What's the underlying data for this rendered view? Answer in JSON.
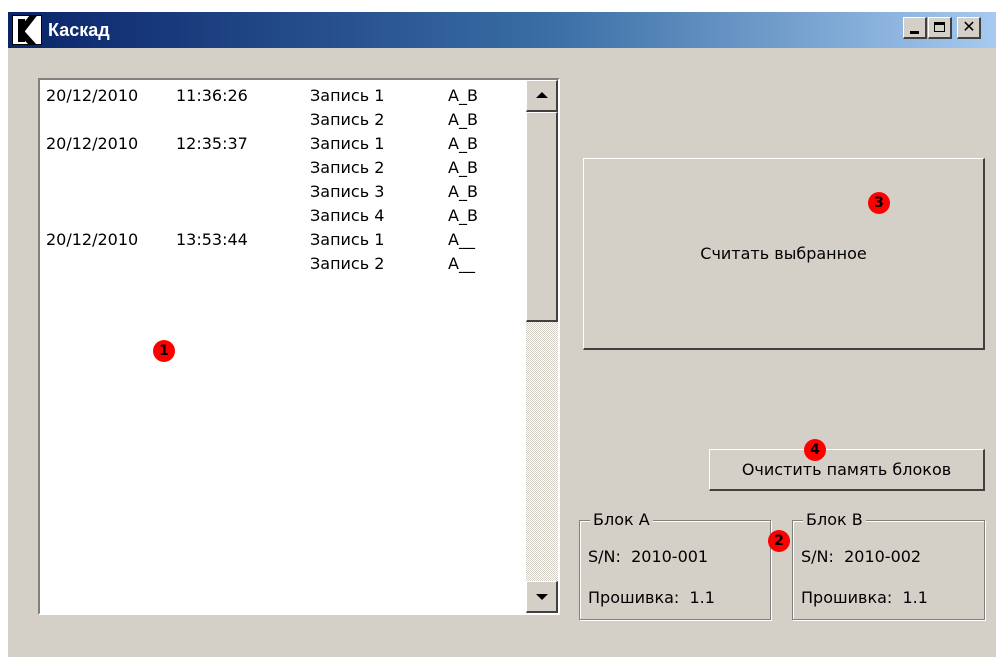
{
  "window": {
    "title": "Каскад",
    "logo_letter": "K",
    "icons": {
      "logo": "app-logo-k-icon",
      "minimize": "minimize-icon",
      "maximize": "maximize-icon",
      "close": "close-icon"
    },
    "close_glyph": "✕"
  },
  "records_list": {
    "rows": [
      {
        "date": "20/12/2010",
        "time": "11:36:26",
        "record": "Запись 1",
        "blocks": "A_B"
      },
      {
        "date": "",
        "time": "",
        "record": "Запись 2",
        "blocks": "A_B"
      },
      {
        "date": "20/12/2010",
        "time": "12:35:37",
        "record": "Запись 1",
        "blocks": "A_B"
      },
      {
        "date": "",
        "time": "",
        "record": "Запись 2",
        "blocks": "A_B"
      },
      {
        "date": "",
        "time": "",
        "record": "Запись 3",
        "blocks": "A_B"
      },
      {
        "date": "",
        "time": "",
        "record": "Запись 4",
        "blocks": "A_B"
      },
      {
        "date": "20/12/2010",
        "time": "13:53:44",
        "record": "Запись 1",
        "blocks": "A__"
      },
      {
        "date": "",
        "time": "",
        "record": "Запись 2",
        "blocks": "A__"
      }
    ]
  },
  "actions": {
    "read_selected": "Считать выбранное",
    "clear_memory": "Очистить память блоков"
  },
  "block_a": {
    "title": "Блок А",
    "sn_label": "S/N:",
    "sn_value": "2010-001",
    "fw_label": "Прошивка:",
    "fw_value": "1.1"
  },
  "block_b": {
    "title": "Блок В",
    "sn_label": "S/N:",
    "sn_value": "2010-002",
    "fw_label": "Прошивка:",
    "fw_value": "1.1"
  },
  "markers": {
    "m1": "1",
    "m2": "2",
    "m3": "3",
    "m4": "4",
    "color": "#ff0000"
  },
  "colors": {
    "titlebar_start": "#0a246a",
    "titlebar_end": "#a6caf0",
    "face": "#d4d0c8"
  }
}
